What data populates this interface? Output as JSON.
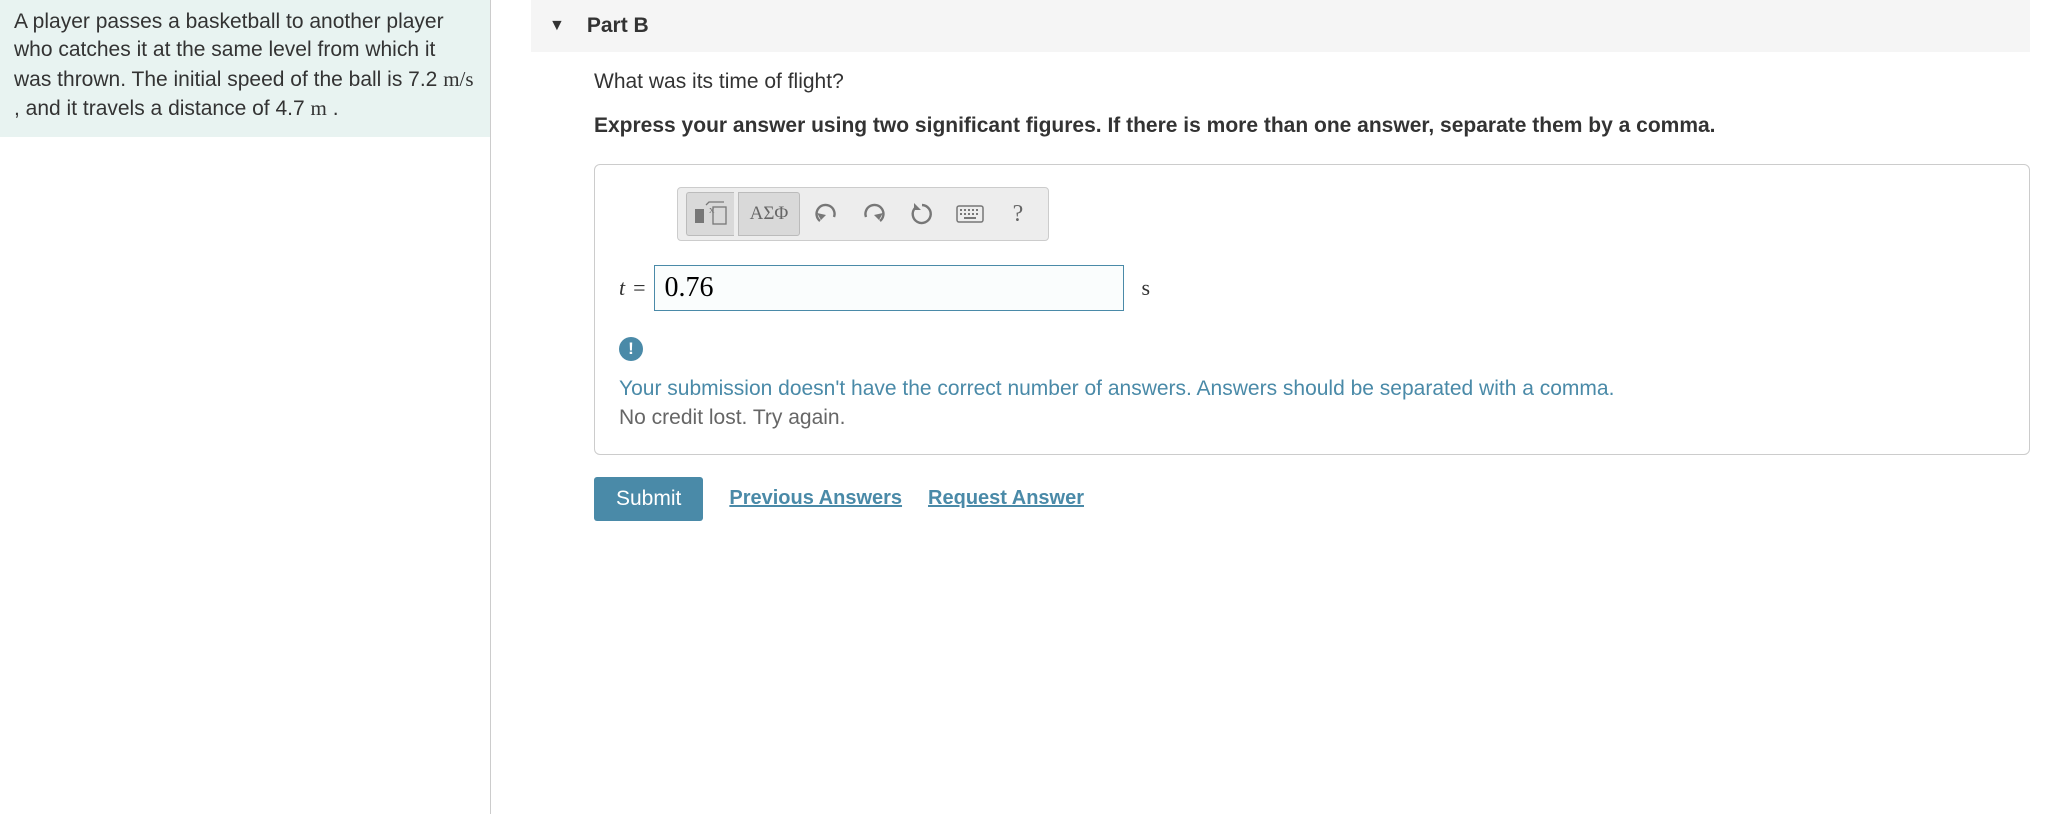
{
  "problem": {
    "text_pre": "A player passes a basketball to another player who catches it at the same level from which it was thrown. The initial speed of the ball is 7.2 ",
    "unit_speed": "m/s",
    "text_mid": " , and it travels a distance of 4.7 ",
    "unit_dist": "m",
    "text_post": " ."
  },
  "part": {
    "label": "Part B",
    "question": "What was its time of flight?",
    "instructions": "Express your answer using two significant figures. If there is more than one answer, separate them by a comma."
  },
  "toolbar": {
    "greek_label": "ΑΣΦ",
    "help_label": "?"
  },
  "answer": {
    "variable": "t",
    "equals": "=",
    "value": "0.76",
    "unit": "s"
  },
  "feedback": {
    "icon": "!",
    "message": "Your submission doesn't have the correct number of answers. Answers should be separated with a comma.",
    "sub": "No credit lost. Try again."
  },
  "actions": {
    "submit": "Submit",
    "previous": "Previous Answers",
    "request": "Request Answer"
  }
}
